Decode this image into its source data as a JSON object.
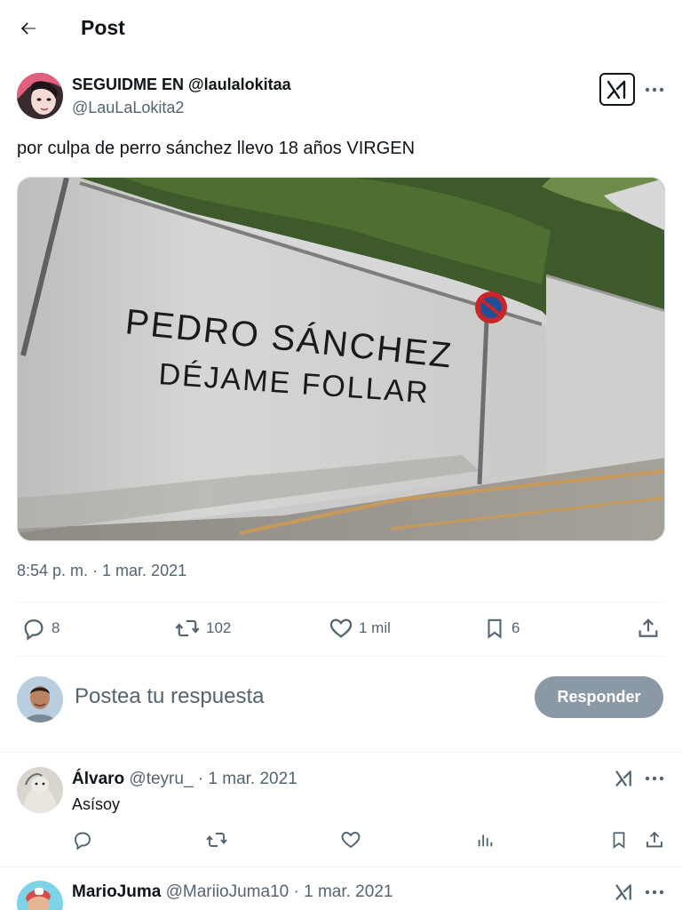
{
  "header": {
    "title": "Post"
  },
  "post": {
    "author_name": "SEGUIDME EN @laulalokitaa",
    "author_handle": "@LauLaLokita2",
    "text": "por culpa de perro sánchez llevo 18 años VIRGEN",
    "image": {
      "graffiti_line1": "PEDRO SÁNCHEZ",
      "graffiti_line2": "DÉJAME FOLLAR"
    },
    "timestamp": "8:54 p. m. · 1 mar. 2021",
    "stats": {
      "replies": "8",
      "reposts": "102",
      "likes": "1 mil",
      "bookmarks": "6"
    }
  },
  "reply_composer": {
    "placeholder": "Postea tu respuesta",
    "button_label": "Responder"
  },
  "replies": [
    {
      "name": "Álvaro",
      "handle": "@teyru_",
      "date": "· 1 mar. 2021",
      "text": "Asísoy"
    },
    {
      "name": "MarioJuma",
      "handle": "@MariioJuma10",
      "date": "· 1 mar. 2021",
      "text": ""
    }
  ],
  "colors": {
    "text": "#0f1419",
    "secondary": "#536471",
    "button_disabled": "#8b98a5",
    "divider": "#eff3f4"
  }
}
